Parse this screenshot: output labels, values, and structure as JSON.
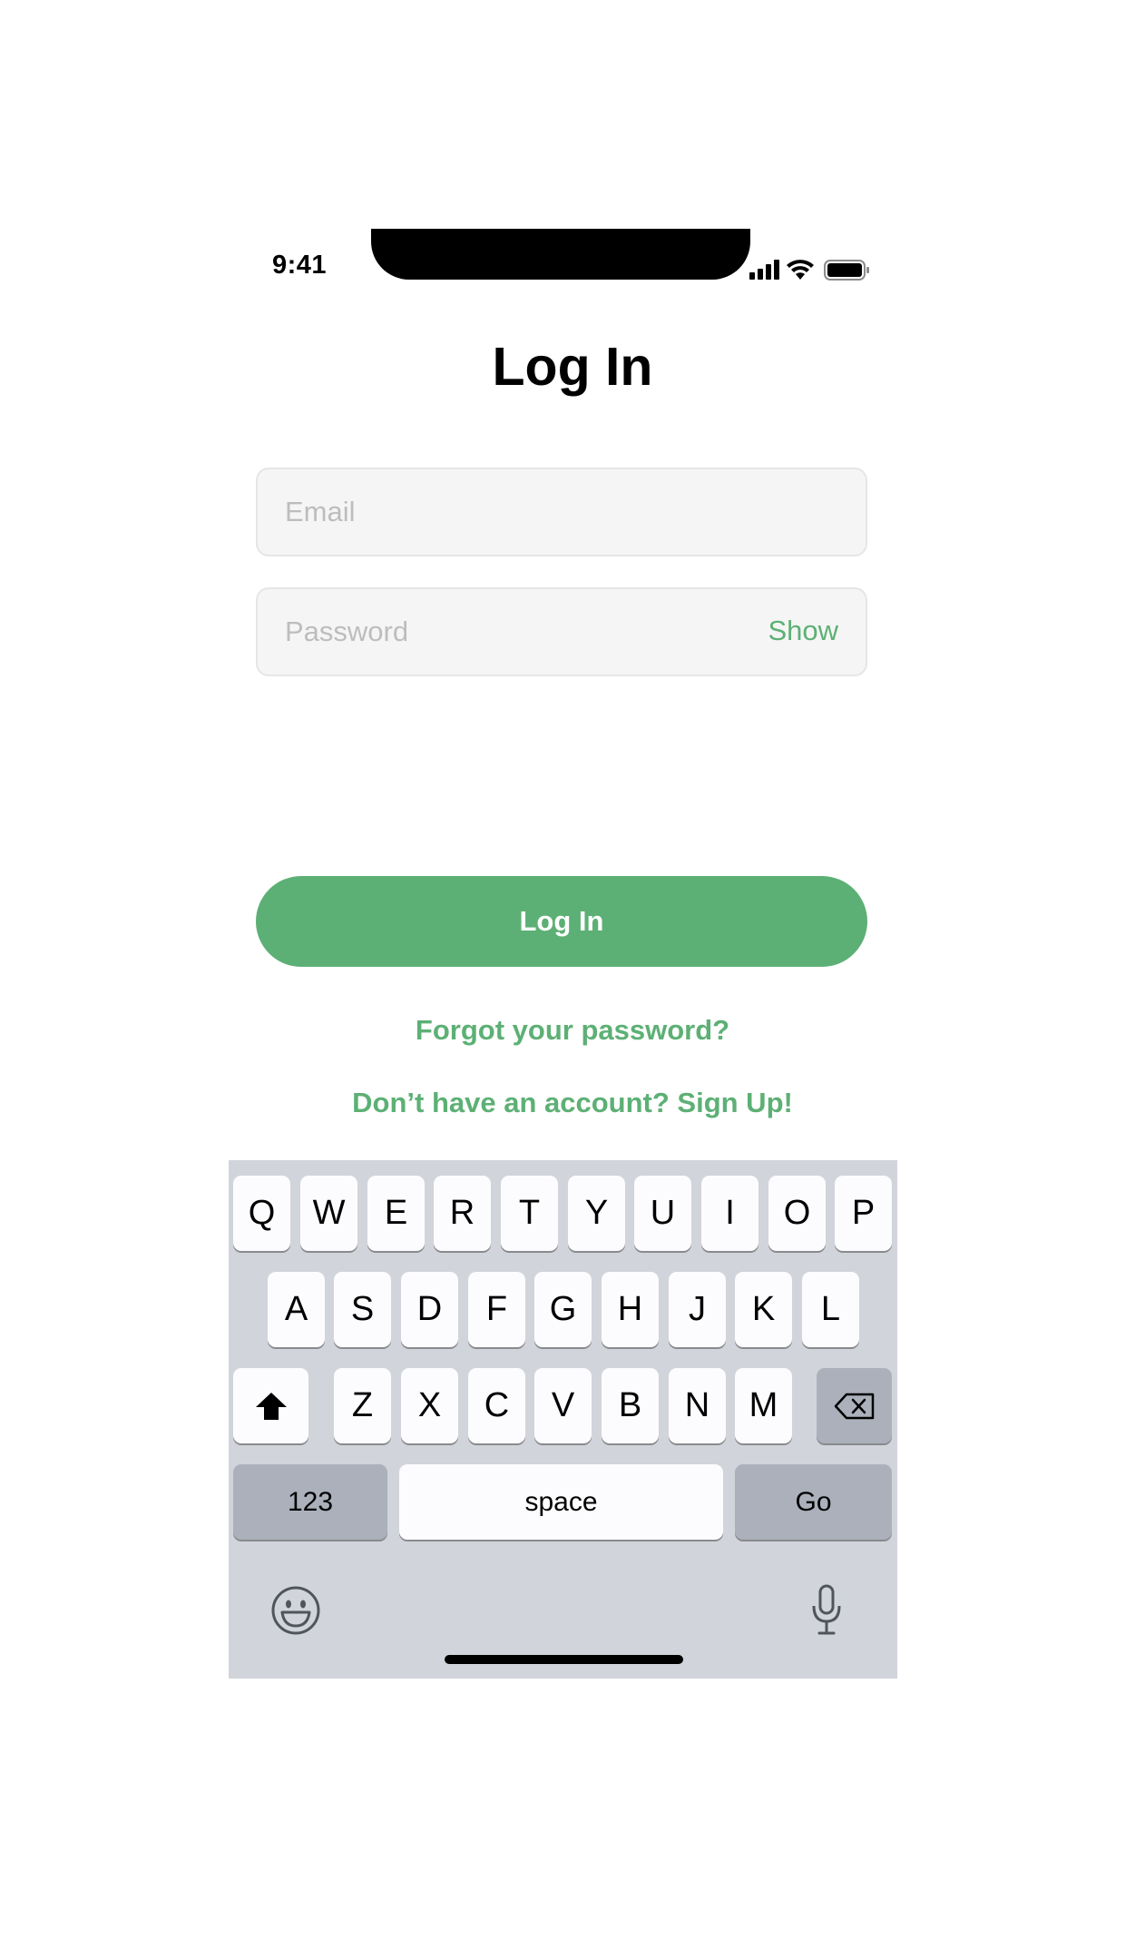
{
  "status_bar": {
    "time": "9:41"
  },
  "title": "Log In",
  "email_field": {
    "placeholder": "Email",
    "value": ""
  },
  "password_field": {
    "placeholder": "Password",
    "value": "",
    "toggle_label": "Show"
  },
  "login_button_label": "Log In",
  "forgot_link": "Forgot your password?",
  "signup_link": "Don’t have an account? Sign Up!",
  "keyboard": {
    "row1": [
      "Q",
      "W",
      "E",
      "R",
      "T",
      "Y",
      "U",
      "I",
      "O",
      "P"
    ],
    "row2": [
      "A",
      "S",
      "D",
      "F",
      "G",
      "H",
      "J",
      "K",
      "L"
    ],
    "row3": [
      "Z",
      "X",
      "C",
      "V",
      "B",
      "N",
      "M"
    ],
    "numbers_key": "123",
    "space_key": "space",
    "go_key": "Go"
  },
  "colors": {
    "accent": "#5db075",
    "field_bg": "#f5f5f5",
    "keyboard_bg": "#d1d4da"
  }
}
